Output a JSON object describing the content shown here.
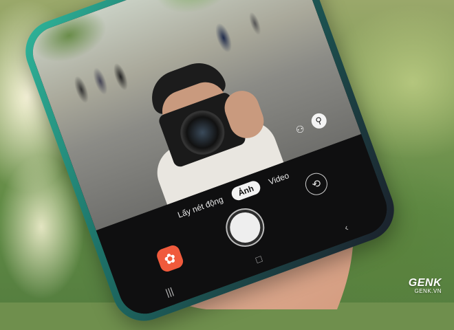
{
  "photo": {
    "background_colors": {
      "bokeh_light": "#fffae1",
      "foliage": "#5f8a44"
    },
    "phone_color": "#2fb59a"
  },
  "camera_app": {
    "modes": [
      {
        "label": "Lấy nét động",
        "active": false
      },
      {
        "label": "Ảnh",
        "active": true
      },
      {
        "label": "Video",
        "active": false
      }
    ],
    "shutter_button": "shutter-icon",
    "gallery_button": "gallery-flower-icon",
    "flip_camera_button": "flip-camera-icon",
    "viewfinder_icons": [
      "single-person-icon",
      "group-icon"
    ],
    "accent_color": "#f05a3c"
  },
  "system_nav": {
    "recents_glyph": "|||",
    "home_glyph": "□",
    "back_glyph": "‹"
  },
  "watermark": {
    "brand": "GENK",
    "domain": "GENK.VN"
  }
}
